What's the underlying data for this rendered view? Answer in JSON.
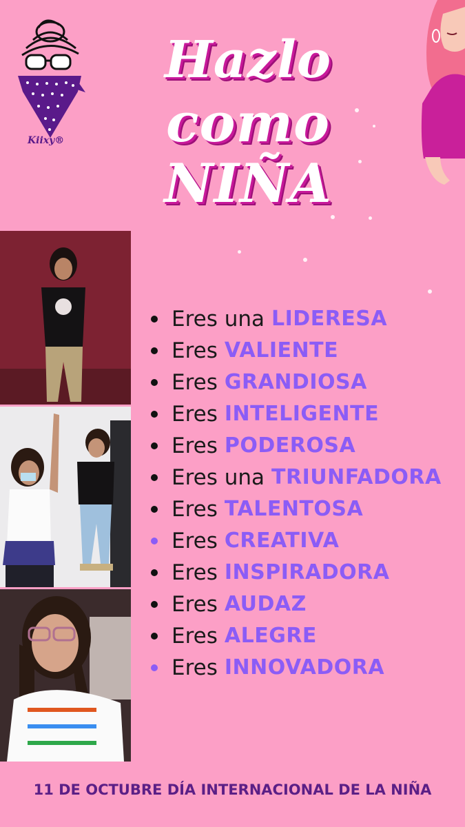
{
  "logo": {
    "brand": "Kiixy®",
    "icon": "bandana-girl-logo"
  },
  "title": {
    "line1": "Hazlo",
    "line2": "como",
    "line3": "NIÑA"
  },
  "illustration": {
    "icon": "woman-illustration"
  },
  "photos": [
    {
      "name": "girl-photo-1"
    },
    {
      "name": "girl-photo-2"
    },
    {
      "name": "girl-photo-3"
    }
  ],
  "list": [
    {
      "prefix": "Eres una",
      "highlight": "LIDERESA",
      "bullet": "black"
    },
    {
      "prefix": "Eres",
      "highlight": "VALIENTE",
      "bullet": "black"
    },
    {
      "prefix": "Eres",
      "highlight": "GRANDIOSA",
      "bullet": "black"
    },
    {
      "prefix": "Eres",
      "highlight": "INTELIGENTE",
      "bullet": "black"
    },
    {
      "prefix": "Eres",
      "highlight": "PODEROSA",
      "bullet": "black"
    },
    {
      "prefix": "Eres una",
      "highlight": "TRIUNFADORA",
      "bullet": "black"
    },
    {
      "prefix": "Eres",
      "highlight": "TALENTOSA",
      "bullet": "black"
    },
    {
      "prefix": "Eres",
      "highlight": "CREATIVA",
      "bullet": "purple"
    },
    {
      "prefix": "Eres",
      "highlight": "INSPIRADORA",
      "bullet": "black"
    },
    {
      "prefix": "Eres",
      "highlight": "AUDAZ",
      "bullet": "black"
    },
    {
      "prefix": "Eres",
      "highlight": "ALEGRE",
      "bullet": "black"
    },
    {
      "prefix": "Eres",
      "highlight": "INNOVADORA",
      "bullet": "purple"
    }
  ],
  "footer": "11 DE OCTUBRE DÍA INTERNACIONAL DE LA NIÑA",
  "colors": {
    "background": "#fc9fc6",
    "accent": "#8b5cf6",
    "footer": "#5b1f86",
    "title_shadow": "#c8199a"
  }
}
